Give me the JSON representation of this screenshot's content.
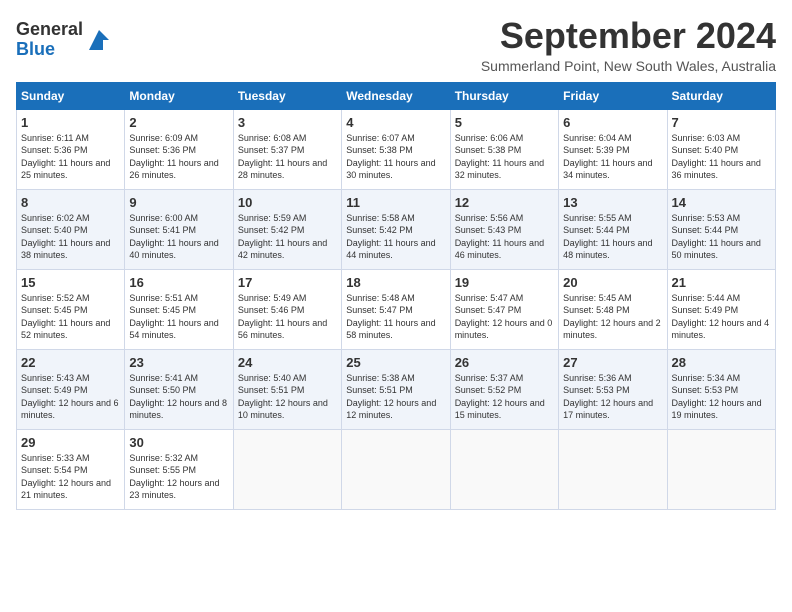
{
  "header": {
    "logo_general": "General",
    "logo_blue": "Blue",
    "month_title": "September 2024",
    "location": "Summerland Point, New South Wales, Australia"
  },
  "weekdays": [
    "Sunday",
    "Monday",
    "Tuesday",
    "Wednesday",
    "Thursday",
    "Friday",
    "Saturday"
  ],
  "weeks": [
    [
      {
        "day": "1",
        "sunrise": "6:11 AM",
        "sunset": "5:36 PM",
        "daylight": "11 hours and 25 minutes."
      },
      {
        "day": "2",
        "sunrise": "6:09 AM",
        "sunset": "5:36 PM",
        "daylight": "11 hours and 26 minutes."
      },
      {
        "day": "3",
        "sunrise": "6:08 AM",
        "sunset": "5:37 PM",
        "daylight": "11 hours and 28 minutes."
      },
      {
        "day": "4",
        "sunrise": "6:07 AM",
        "sunset": "5:38 PM",
        "daylight": "11 hours and 30 minutes."
      },
      {
        "day": "5",
        "sunrise": "6:06 AM",
        "sunset": "5:38 PM",
        "daylight": "11 hours and 32 minutes."
      },
      {
        "day": "6",
        "sunrise": "6:04 AM",
        "sunset": "5:39 PM",
        "daylight": "11 hours and 34 minutes."
      },
      {
        "day": "7",
        "sunrise": "6:03 AM",
        "sunset": "5:40 PM",
        "daylight": "11 hours and 36 minutes."
      }
    ],
    [
      {
        "day": "8",
        "sunrise": "6:02 AM",
        "sunset": "5:40 PM",
        "daylight": "11 hours and 38 minutes."
      },
      {
        "day": "9",
        "sunrise": "6:00 AM",
        "sunset": "5:41 PM",
        "daylight": "11 hours and 40 minutes."
      },
      {
        "day": "10",
        "sunrise": "5:59 AM",
        "sunset": "5:42 PM",
        "daylight": "11 hours and 42 minutes."
      },
      {
        "day": "11",
        "sunrise": "5:58 AM",
        "sunset": "5:42 PM",
        "daylight": "11 hours and 44 minutes."
      },
      {
        "day": "12",
        "sunrise": "5:56 AM",
        "sunset": "5:43 PM",
        "daylight": "11 hours and 46 minutes."
      },
      {
        "day": "13",
        "sunrise": "5:55 AM",
        "sunset": "5:44 PM",
        "daylight": "11 hours and 48 minutes."
      },
      {
        "day": "14",
        "sunrise": "5:53 AM",
        "sunset": "5:44 PM",
        "daylight": "11 hours and 50 minutes."
      }
    ],
    [
      {
        "day": "15",
        "sunrise": "5:52 AM",
        "sunset": "5:45 PM",
        "daylight": "11 hours and 52 minutes."
      },
      {
        "day": "16",
        "sunrise": "5:51 AM",
        "sunset": "5:45 PM",
        "daylight": "11 hours and 54 minutes."
      },
      {
        "day": "17",
        "sunrise": "5:49 AM",
        "sunset": "5:46 PM",
        "daylight": "11 hours and 56 minutes."
      },
      {
        "day": "18",
        "sunrise": "5:48 AM",
        "sunset": "5:47 PM",
        "daylight": "11 hours and 58 minutes."
      },
      {
        "day": "19",
        "sunrise": "5:47 AM",
        "sunset": "5:47 PM",
        "daylight": "12 hours and 0 minutes."
      },
      {
        "day": "20",
        "sunrise": "5:45 AM",
        "sunset": "5:48 PM",
        "daylight": "12 hours and 2 minutes."
      },
      {
        "day": "21",
        "sunrise": "5:44 AM",
        "sunset": "5:49 PM",
        "daylight": "12 hours and 4 minutes."
      }
    ],
    [
      {
        "day": "22",
        "sunrise": "5:43 AM",
        "sunset": "5:49 PM",
        "daylight": "12 hours and 6 minutes."
      },
      {
        "day": "23",
        "sunrise": "5:41 AM",
        "sunset": "5:50 PM",
        "daylight": "12 hours and 8 minutes."
      },
      {
        "day": "24",
        "sunrise": "5:40 AM",
        "sunset": "5:51 PM",
        "daylight": "12 hours and 10 minutes."
      },
      {
        "day": "25",
        "sunrise": "5:38 AM",
        "sunset": "5:51 PM",
        "daylight": "12 hours and 12 minutes."
      },
      {
        "day": "26",
        "sunrise": "5:37 AM",
        "sunset": "5:52 PM",
        "daylight": "12 hours and 15 minutes."
      },
      {
        "day": "27",
        "sunrise": "5:36 AM",
        "sunset": "5:53 PM",
        "daylight": "12 hours and 17 minutes."
      },
      {
        "day": "28",
        "sunrise": "5:34 AM",
        "sunset": "5:53 PM",
        "daylight": "12 hours and 19 minutes."
      }
    ],
    [
      {
        "day": "29",
        "sunrise": "5:33 AM",
        "sunset": "5:54 PM",
        "daylight": "12 hours and 21 minutes."
      },
      {
        "day": "30",
        "sunrise": "5:32 AM",
        "sunset": "5:55 PM",
        "daylight": "12 hours and 23 minutes."
      },
      null,
      null,
      null,
      null,
      null
    ]
  ]
}
